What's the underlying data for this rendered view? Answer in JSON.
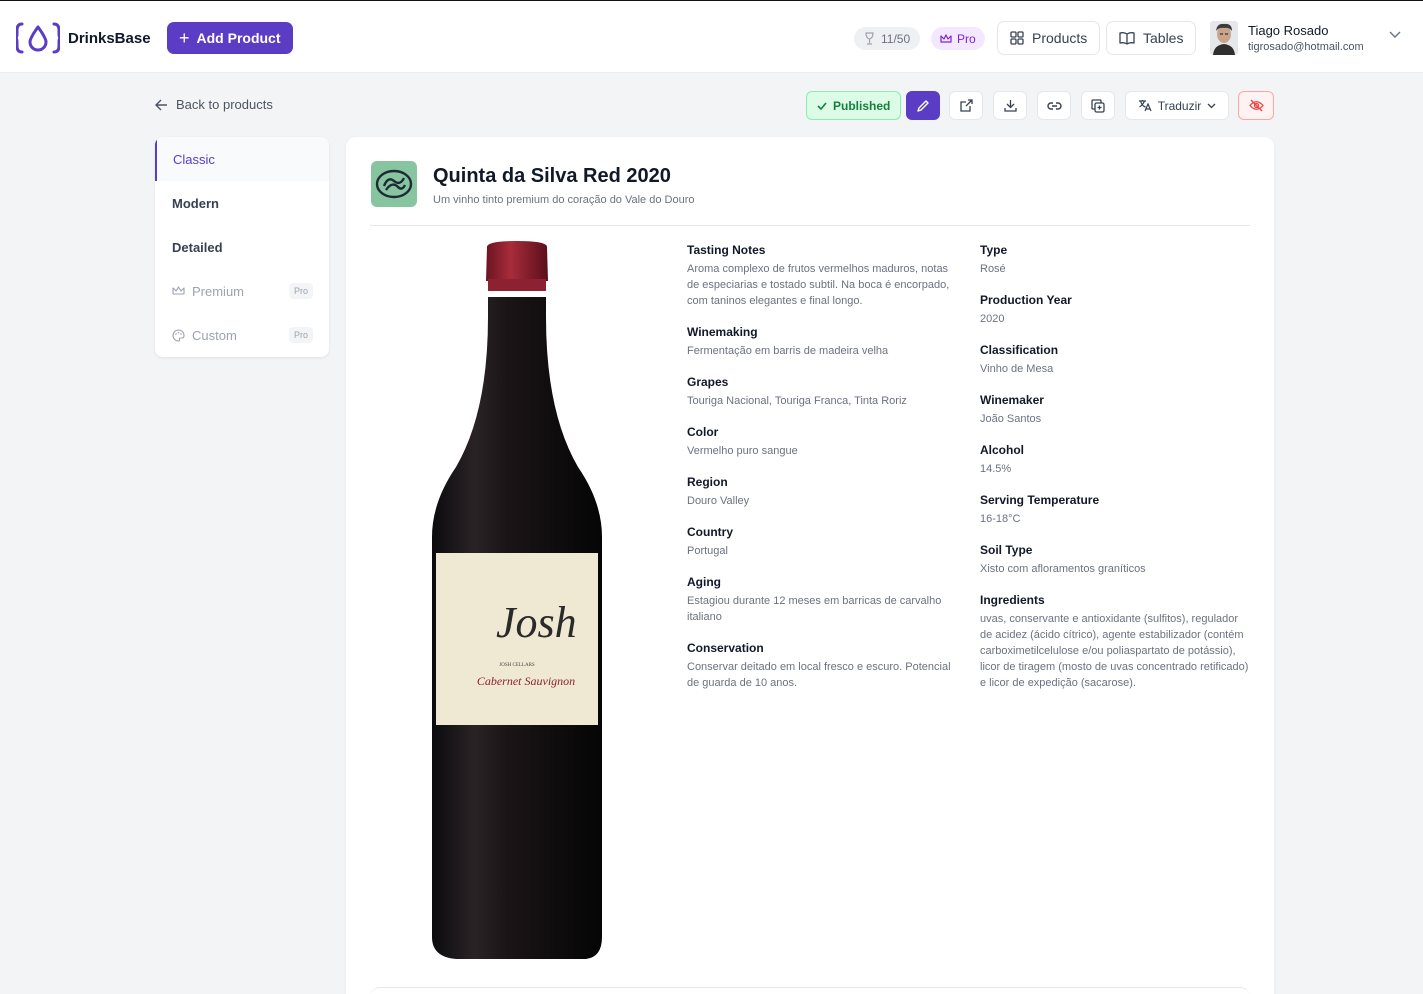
{
  "app": {
    "name": "DrinksBase",
    "add_product_label": "Add Product",
    "usage": "11/50",
    "plan": "Pro",
    "nav": {
      "products": "Products",
      "tables": "Tables"
    },
    "user": {
      "name": "Tiago Rosado",
      "email": "tigrosado@hotmail.com"
    }
  },
  "toolbar": {
    "back_label": "Back to products",
    "status": "Published",
    "translate_label": "Traduzir"
  },
  "templates": [
    {
      "label": "Classic",
      "active": true
    },
    {
      "label": "Modern"
    },
    {
      "label": "Detailed"
    },
    {
      "label": "Premium",
      "badge": "Pro"
    },
    {
      "label": "Custom",
      "badge": "Pro"
    }
  ],
  "product": {
    "title": "Quinta da Silva Red 2020",
    "subtitle": "Um vinho tinto premium do coração do Vale do Douro",
    "label_text": {
      "brand": "Josh",
      "cellars": "JOSH CELLARS",
      "variety": "Cabernet Sauvignon"
    },
    "left_fields": [
      {
        "label": "Tasting Notes",
        "value": "Aroma complexo de frutos vermelhos maduros, notas de especiarias e tostado subtil. Na boca é encorpado, com taninos elegantes e final longo."
      },
      {
        "label": "Winemaking",
        "value": "Fermentação em barris de madeira velha"
      },
      {
        "label": "Grapes",
        "value": "Touriga Nacional, Touriga Franca, Tinta Roriz"
      },
      {
        "label": "Color",
        "value": "Vermelho puro sangue"
      },
      {
        "label": "Region",
        "value": "Douro Valley"
      },
      {
        "label": "Country",
        "value": "Portugal"
      },
      {
        "label": "Aging",
        "value": "Estagiou durante 12 meses em barricas de carvalho italiano"
      },
      {
        "label": "Conservation",
        "value": "Conservar deitado em local fresco e escuro. Potencial de guarda de 10 anos."
      }
    ],
    "right_fields": [
      {
        "label": "Type",
        "value": "Rosé"
      },
      {
        "label": "Production Year",
        "value": "2020"
      },
      {
        "label": "Classification",
        "value": "Vinho de Mesa"
      },
      {
        "label": "Winemaker",
        "value": "João Santos"
      },
      {
        "label": "Alcohol",
        "value": "14.5%"
      },
      {
        "label": "Serving Temperature",
        "value": "16-18°C"
      },
      {
        "label": "Soil Type",
        "value": "Xisto com afloramentos graníticos"
      },
      {
        "label": "Ingredients",
        "value": "uvas, conservante e antioxidante (sulfitos), regulador de acidez (ácido cítrico), agente estabilizador (contém carboximetilcelulose e/ou poliaspartato de potássio), licor de tiragem (mosto de uvas concentrado retificado) e licor de expedição (sacarose)."
      }
    ]
  },
  "colors": {
    "accent": "#5b3cc4",
    "published_bg": "#dcfce7",
    "published_text": "#15803d",
    "danger": "#ef4444",
    "logo_bg": "#86c5a0"
  }
}
